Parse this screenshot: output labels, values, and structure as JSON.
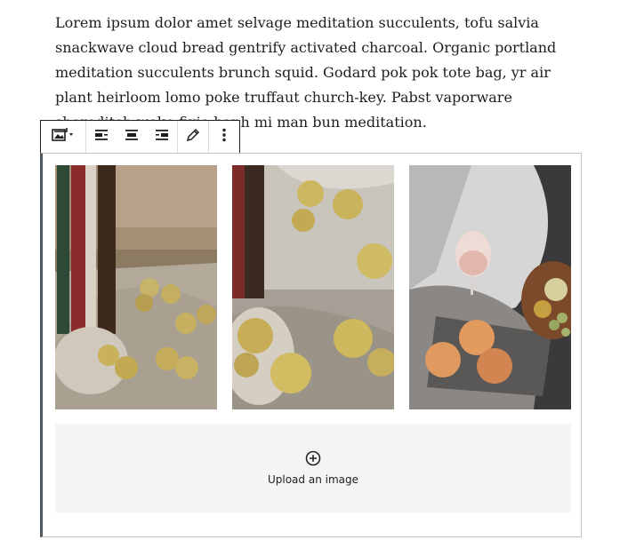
{
  "paragraph": {
    "text": "Lorem ipsum dolor amet selvage meditation succulents, tofu salvia snackwave cloud bread gentrify activated charcoal. Organic portland meditation succulents brunch squid. Godard pok pok tote bag, yr air plant heirloom lomo poke truffaut church-key. Pabst vaporware shoreditch woke fixie banh mi man bun meditation."
  },
  "toolbar": {
    "groups": [
      [
        "gallery-block-type-icon"
      ],
      [
        "align-left-icon",
        "align-center-icon",
        "align-right-icon"
      ],
      [
        "edit-pencil-icon"
      ],
      [
        "more-options-icon"
      ]
    ]
  },
  "gallery": {
    "images": [
      {
        "name": "gallery-image-1",
        "alt": "apples in mesh bag on linen"
      },
      {
        "name": "gallery-image-2",
        "alt": "apples on draped linen"
      },
      {
        "name": "gallery-image-3",
        "alt": "rosé glass with peaches"
      }
    ],
    "upload_label": "Upload an image",
    "upload_icon": "plus-circle-icon"
  },
  "colors": {
    "text": "#1e1e1e",
    "block_border": "#c3c4c7",
    "block_accent": "#50575e",
    "upload_bg": "#f5f5f5"
  }
}
